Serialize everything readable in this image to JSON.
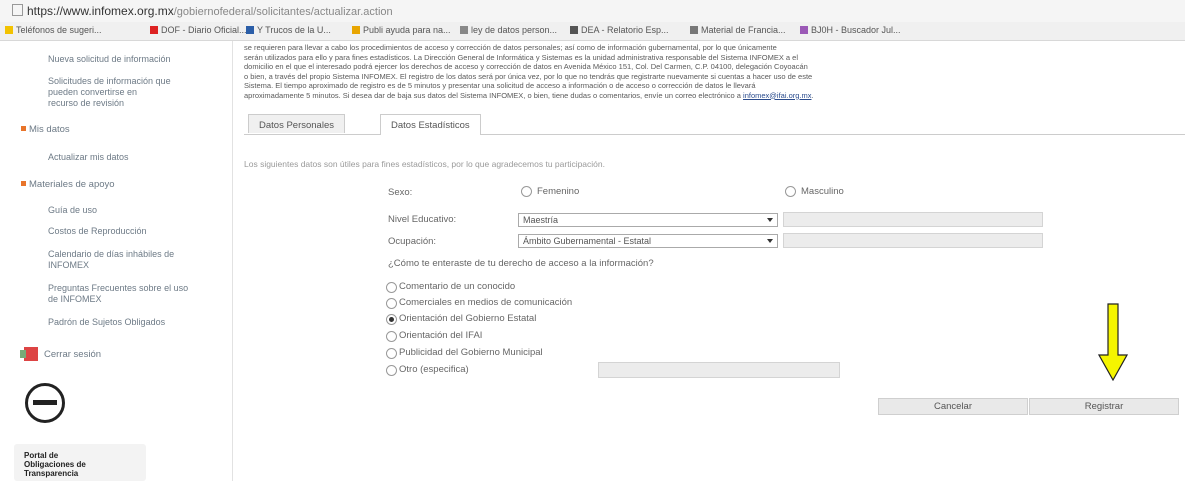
{
  "browser": {
    "url_host": "https://www.infomex.org.mx",
    "url_path": "/gobiernofederal/solicitantes/actualizar.action",
    "bookmarks": [
      "Teléfonos de sugeri...",
      "DOF - Diario Oficial...",
      "Y Trucos de la U...",
      "Publi ayuda para na...",
      "ley de datos person...",
      "DEA - Relatorio Esp...",
      "Material de Francia...",
      "BJ0H - Buscador Jul..."
    ],
    "bookmark_colors": [
      "#f2c200",
      "#d22",
      "#2b5ea8",
      "#e8a500",
      "#888",
      "#555",
      "#777",
      "#9b59b6"
    ]
  },
  "sidebar": {
    "items_top": [
      "Nueva solicitud de información",
      "Solicitudes de información que",
      "pueden convertirse en",
      "recurso de revisión"
    ],
    "mis_datos": "Mis datos",
    "actualizar": "Actualizar mis datos",
    "materiales": "Materiales de apoyo",
    "material_items": [
      "Guía de uso",
      "Costos de Reproducción",
      "Calendario de días inhábiles de",
      "INFOMEX",
      "Preguntas Frecuentes sobre el uso",
      "de INFOMEX",
      "Padrón de Sujetos Obligados"
    ],
    "logout": "Cerrar sesión",
    "portal_lines": [
      "Portal de",
      "Obligaciones de",
      "Transparencia"
    ]
  },
  "notice": {
    "lines": [
      "se requieren para llevar a cabo los procedimientos de acceso y corrección de datos personales; así como de información gubernamental, por lo que únicamente",
      "serán utilizados para ello y para fines estadísticos. La Dirección General de Informática y Sistemas es la unidad administrativa responsable del Sistema INFOMEX a el",
      "domicilio en el que el interesado podrá ejercer los derechos de acceso y corrección de datos en Avenida México 151, Col. Del Carmen, C.P. 04100, delegación Coyoacán",
      "o bien, a través del propio Sistema INFOMEX. El registro de los datos será por única vez, por lo que no tendrás que registrarte nuevamente si cuentas a hacer uso de este",
      "Sistema. El tiempo aproximado de registro es de 5 minutos y presentar una solicitud de acceso a información o de acceso o corrección de datos le llevará"
    ],
    "last_line": "aproximadamente 5 minutos. Si desea dar de baja sus datos del Sistema INFOMEX, o bien, tiene dudas o comentarios, envíe un correo electrónico a",
    "email": "infomex@ifai.org.mx"
  },
  "tabs": [
    "Datos Personales",
    "Datos Estadísticos"
  ],
  "form": {
    "intro": "Los siguientes datos son útiles para fines estadísticos, por lo que agradecemos tu participación.",
    "sexo_label": "Sexo:",
    "sexo_options": [
      "Femenino",
      "Masculino"
    ],
    "nivel_label": "Nivel Educativo:",
    "nivel_value": "Maestría",
    "ocupacion_label": "Ocupación:",
    "ocupacion_value": "Ámbito Gubernamental - Estatal",
    "question": "¿Cómo te enteraste de tu derecho de acceso a la información?",
    "options": [
      "Comentario de un conocido",
      "Comerciales en medios de comunicación",
      "Orientación del Gobierno Estatal",
      "Orientación del IFAI",
      "Publicidad del Gobierno Municipal",
      "Otro (especifica)"
    ],
    "selected_option": 2
  },
  "buttons": {
    "cancel": "Cancelar",
    "register": "Registrar"
  },
  "colors": {
    "annotation_arrow": "#f5f500",
    "bullet": "#e8742a",
    "link": "#2a4b8d"
  }
}
